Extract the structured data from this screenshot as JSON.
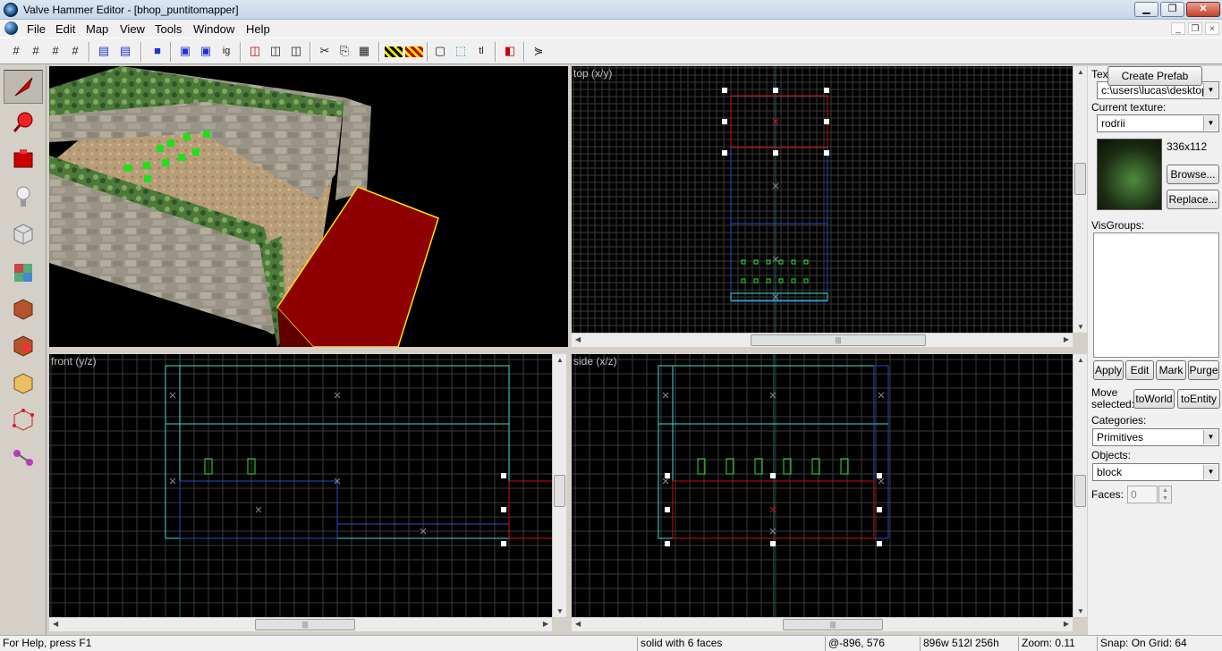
{
  "window": {
    "title": "Valve Hammer Editor - [bhop_puntitomapper]",
    "minimize": "▁",
    "maximize": "❐",
    "close": "✕"
  },
  "menu": [
    "File",
    "Edit",
    "Map",
    "View",
    "Tools",
    "Window",
    "Help"
  ],
  "mdi_controls": {
    "minimize": "_",
    "restore": "❐",
    "close": "×"
  },
  "toolbar_icons": [
    "grid-toggle-icon",
    "grid-3d-icon",
    "grid-smaller-icon",
    "grid-larger-icon",
    "group-icon",
    "ungroup-icon",
    "carve-icon",
    "hollow-icon",
    "texture-lock-icon",
    "ignore-groups-icon",
    "hide-objects-icon",
    "show-objects-icon",
    "cut-icon",
    "copy-icon",
    "paste-icon",
    "texture-application-icon",
    "decal-icon",
    "select-icon",
    "select-handles-icon",
    "entity-report-icon",
    "flip-icon",
    "run-map-icon"
  ],
  "tools": [
    "selection-tool",
    "magnify-tool",
    "camera-tool",
    "entity-tool",
    "block-tool",
    "texture-application-tool",
    "apply-texture-tool",
    "decal-tool",
    "clip-tool",
    "vertex-tool",
    "path-tool"
  ],
  "viewports": {
    "top": {
      "label": "top (x/y)"
    },
    "front": {
      "label": "front (y/z)"
    },
    "side": {
      "label": "side (x/z)"
    }
  },
  "panel": {
    "texture_group_label": "Texture group:",
    "texture_group_value": "c:\\users\\lucas\\desktop\\",
    "current_texture_label": "Current texture:",
    "current_texture_value": "rodrii",
    "texture_size": "336x112",
    "browse": "Browse...",
    "replace": "Replace...",
    "visgroups_label": "VisGroups:",
    "apply": "Apply",
    "edit": "Edit",
    "mark": "Mark",
    "purge": "Purge",
    "move_selected_label_1": "Move",
    "move_selected_label_2": "selected:",
    "to_world": "toWorld",
    "to_entity": "toEntity",
    "categories_label": "Categories:",
    "categories_value": "Primitives",
    "objects_label": "Objects:",
    "objects_value": "block",
    "faces_label": "Faces:",
    "faces_value": "0",
    "create_prefab": "Create Prefab"
  },
  "status": {
    "help": "For Help, press F1",
    "selection": "solid with 6 faces",
    "coords": "@-896, 576",
    "dims": "896w 512l 256h",
    "zoom": "Zoom: 0.11",
    "snap": "Snap: On Grid: 64"
  },
  "colors": {
    "grid": "#3a3a3a",
    "grid_major": "#1e6b6b",
    "selection": "#d01010",
    "brush_blue": "#2050d0",
    "brush_cyan": "#40e0d0",
    "entity_green": "#30e030"
  }
}
